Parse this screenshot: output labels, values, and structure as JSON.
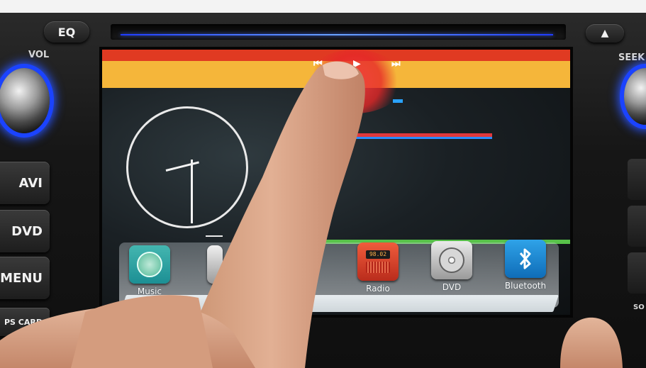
{
  "photo": {
    "subject": "",
    "hardware_buttons": {
      "eq": "EQ",
      "navi": "AVI",
      "dvd": "DVD",
      "menu": "MENU",
      "gps_card": "PS CARD",
      "vol_label": "VOL",
      "seek_label": "SEEK",
      "sd_partial": "SO"
    },
    "media_controls": {
      "prev": "⏮",
      "play_pause": "▶",
      "next": "⏭"
    },
    "radio_display": "98.02",
    "apps": [
      {
        "name": "Music",
        "icon": "music-icon"
      },
      {
        "name": "Radio",
        "icon": "radio-icon"
      },
      {
        "name": "DVD",
        "icon": "dvd-icon"
      },
      {
        "name": "Bluetooth",
        "icon": "bluetooth-icon"
      }
    ],
    "colors": {
      "accent_blue": "#2a55ff",
      "media_bar_yellow": "#f5b63a",
      "media_bar_red": "#e03a22"
    }
  }
}
